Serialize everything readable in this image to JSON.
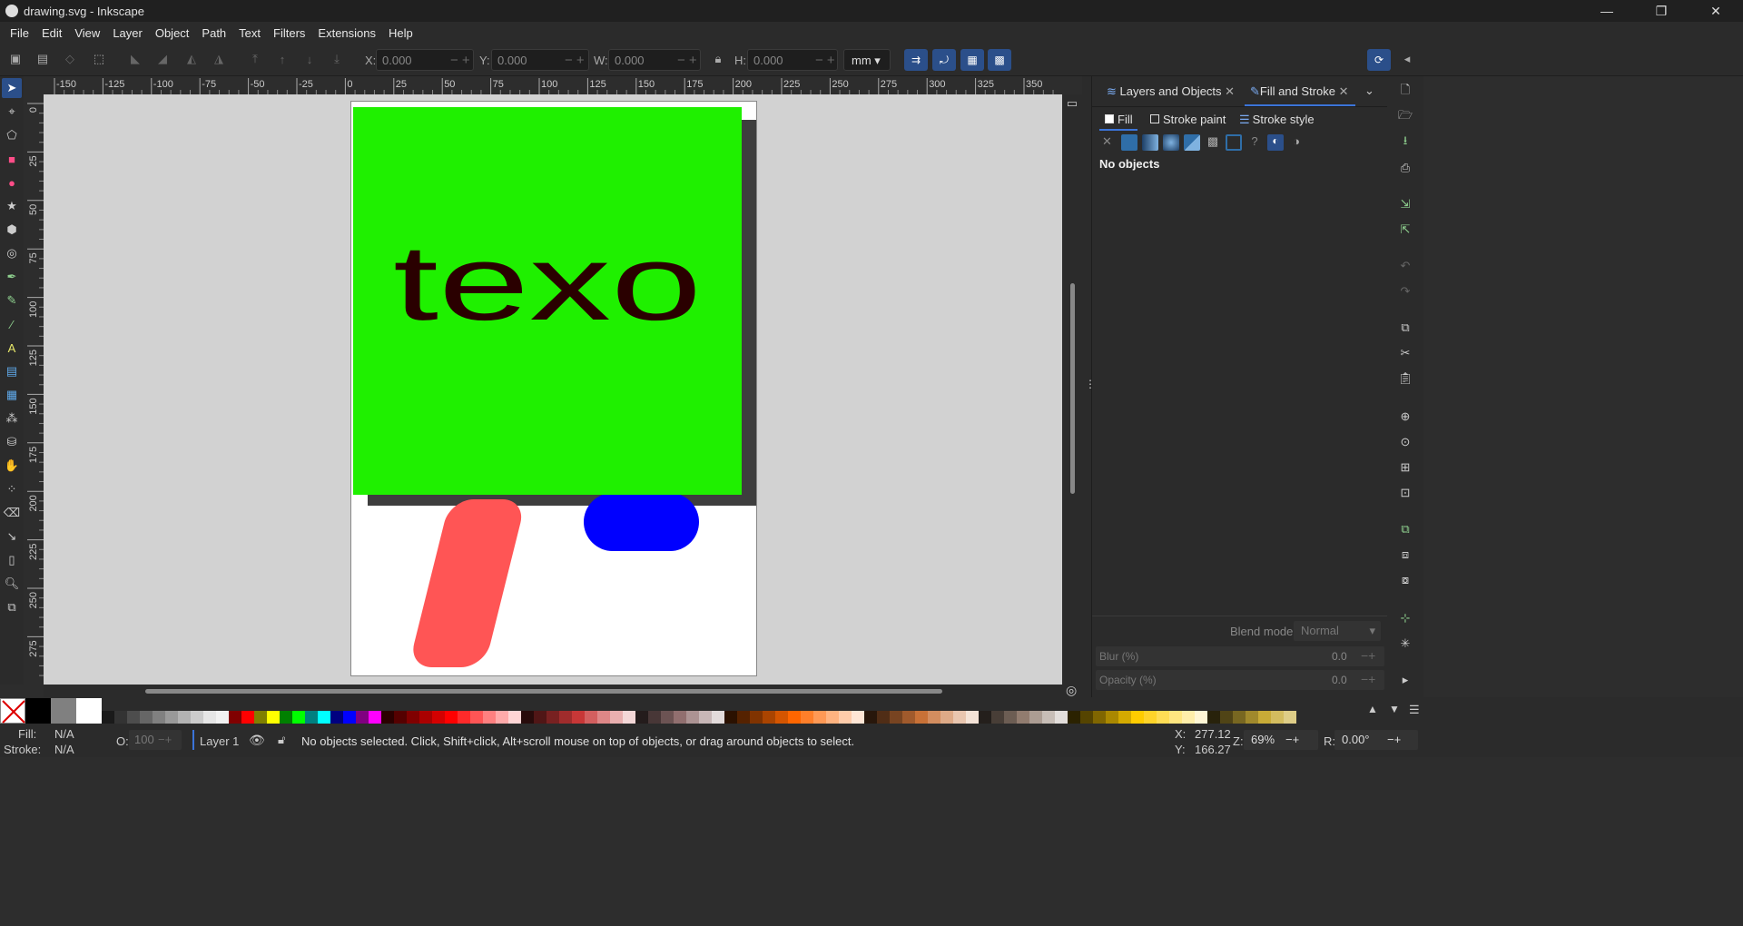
{
  "window": {
    "title": "drawing.svg - Inkscape",
    "min": "—",
    "max": "❐",
    "close": "✕"
  },
  "menu": [
    "File",
    "Edit",
    "View",
    "Layer",
    "Object",
    "Path",
    "Text",
    "Filters",
    "Extensions",
    "Help"
  ],
  "coords": {
    "x_label": "X:",
    "x_value": "0.000",
    "y_label": "Y:",
    "y_value": "0.000",
    "w_label": "W:",
    "w_value": "0.000",
    "h_label": "H:",
    "h_value": "0.000",
    "units": "mm"
  },
  "ruler_ticks": [
    "-150",
    "-125",
    "-100",
    "-75",
    "-50",
    "-25",
    "0",
    "25",
    "50",
    "75",
    "100",
    "125",
    "150",
    "175",
    "200",
    "225",
    "250",
    "275",
    "300",
    "325",
    "350"
  ],
  "vruler_ticks": [
    "0",
    "25",
    "50",
    "75",
    "100",
    "125",
    "150",
    "175",
    "200",
    "225",
    "250",
    "275"
  ],
  "canvas": {
    "text": "texo",
    "green": "#1ff000",
    "shadow": "#3e3e3e",
    "blue": "#0000ff",
    "salmon": "#ff5555",
    "dark_red": "#800000",
    "text_color": "#2a0000"
  },
  "dock": {
    "tab1": "Layers and Objects",
    "tab2": "Fill and Stroke",
    "fill_tab": "Fill",
    "stroke_paint_tab": "Stroke paint",
    "stroke_style_tab": "Stroke style",
    "no_objects": "No objects",
    "blend_label": "Blend mode:",
    "blend_value": "Normal",
    "blur_label": "Blur (%)",
    "blur_value": "0.0",
    "opacity_label": "Opacity (%)",
    "opacity_value": "0.0"
  },
  "status": {
    "fill_label": "Fill:",
    "fill_value": "N/A",
    "stroke_label": "Stroke:",
    "stroke_value": "N/A",
    "o_label": "O:",
    "o_value": "100",
    "layer": "Layer 1",
    "message": "No objects selected. Click, Shift+click, Alt+scroll mouse on top of objects, or drag around objects to select.",
    "x_label": "X:",
    "x_value": "277.12",
    "y_label": "Y:",
    "y_value": "166.27",
    "z_label": "Z:",
    "zoom": "69%",
    "r_label": "R:",
    "rotation": "0.00°"
  },
  "palette_colors": [
    "#000000",
    "#808080",
    "#ffffff",
    "#1a1a1a",
    "#333333",
    "#4d4d4d",
    "#666666",
    "#808080",
    "#999999",
    "#b3b3b3",
    "#cccccc",
    "#e6e6e6",
    "#f2f2f2",
    "#800000",
    "#ff0000",
    "#808000",
    "#ffff00",
    "#008000",
    "#00ff00",
    "#008080",
    "#00ffff",
    "#000080",
    "#0000ff",
    "#800080",
    "#ff00ff",
    "#2b0000",
    "#550000",
    "#800000",
    "#aa0000",
    "#d40000",
    "#ff0000",
    "#ff2a2a",
    "#ff5555",
    "#ff8080",
    "#ffaaaa",
    "#ffd5d5",
    "#280b0b",
    "#501616",
    "#782121",
    "#a02c2c",
    "#c83737",
    "#d35f5f",
    "#de8787",
    "#e9afaf",
    "#f4d7d7",
    "#241c1c",
    "#483737",
    "#6c5353",
    "#916f6f",
    "#ac9393",
    "#c8b7b7",
    "#e3dbdb",
    "#2b1100",
    "#552200",
    "#803300",
    "#aa4400",
    "#d45500",
    "#ff6600",
    "#ff7f2a",
    "#ff9955",
    "#ffb380",
    "#ffccaa",
    "#ffe6d5",
    "#28170b",
    "#502d16",
    "#784421",
    "#a05a2c",
    "#c87137",
    "#d38d5f",
    "#deaa87",
    "#e9c6af",
    "#f4e3d7",
    "#241f1c",
    "#483e37",
    "#6c5d53",
    "#917c6f",
    "#ac9d93",
    "#c8beb7",
    "#e3dedb",
    "#2b2200",
    "#554400",
    "#806600",
    "#aa8800",
    "#d4aa00",
    "#ffcc00",
    "#ffd42a",
    "#ffdd55",
    "#ffe680",
    "#ffeeaa",
    "#fff6d5",
    "#28220b",
    "#504416",
    "#786721",
    "#a0892c",
    "#c8ab37",
    "#d3bc5f",
    "#decd87"
  ]
}
